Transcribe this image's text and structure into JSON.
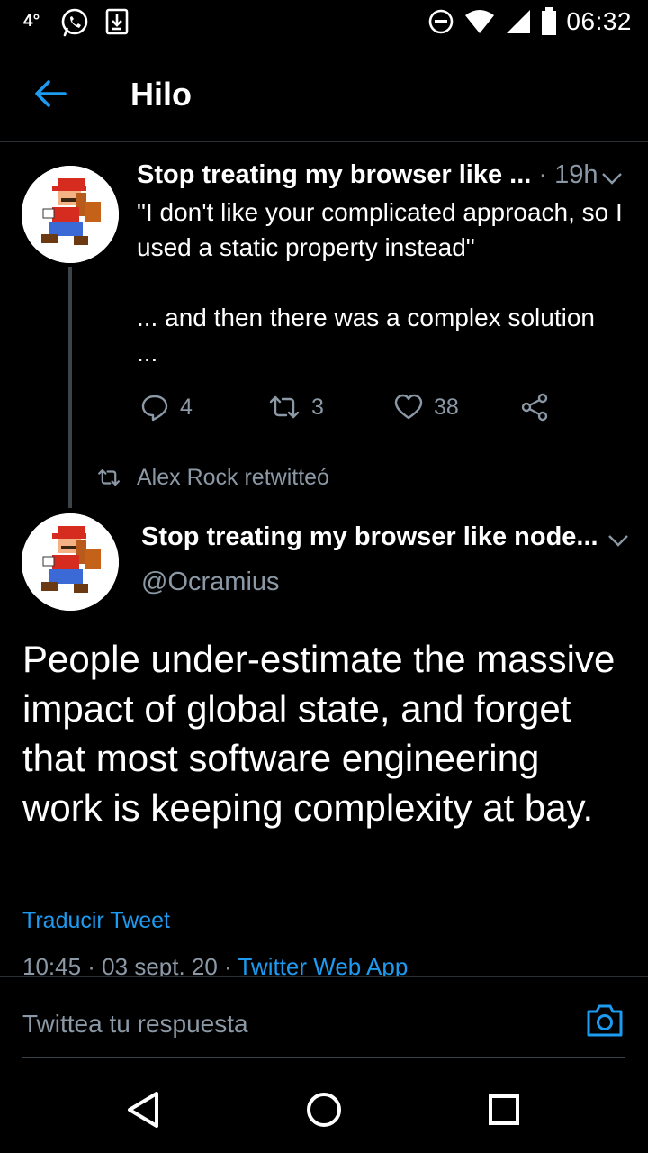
{
  "status_bar": {
    "temperature": "4°",
    "time": "06:32",
    "icons": [
      "whatsapp-icon",
      "download-icon",
      "dnd-icon",
      "wifi-icon",
      "signal-icon",
      "battery-icon"
    ]
  },
  "header": {
    "title": "Hilo",
    "back_icon": "arrow-left-icon"
  },
  "thread_tweet": {
    "name": "Stop treating my browser like ...",
    "time": "· 19h",
    "body": "\"I don't like your complicated approach, so I used a static property instead\"\n\n... and then there was a complex solution ...",
    "actions": {
      "replies": "4",
      "retweets": "3",
      "likes": "38"
    }
  },
  "retweet_note": {
    "text": "Alex Rock retwitteó"
  },
  "main_tweet": {
    "name": "Stop treating my browser like node...",
    "handle": "@Ocramius",
    "body": "People under-estimate the massive impact of global state, and forget that most software engineering work is keeping complexity at bay.",
    "translate": "Traducir Tweet",
    "timestamp": "10:45 · 03 sept. 20 · ",
    "source": "Twitter Web App"
  },
  "reply_bar": {
    "placeholder": "Twittea tu respuesta"
  },
  "colors": {
    "accent": "#1d9bf0",
    "secondary_text": "#8b98a5",
    "background": "#000000"
  }
}
